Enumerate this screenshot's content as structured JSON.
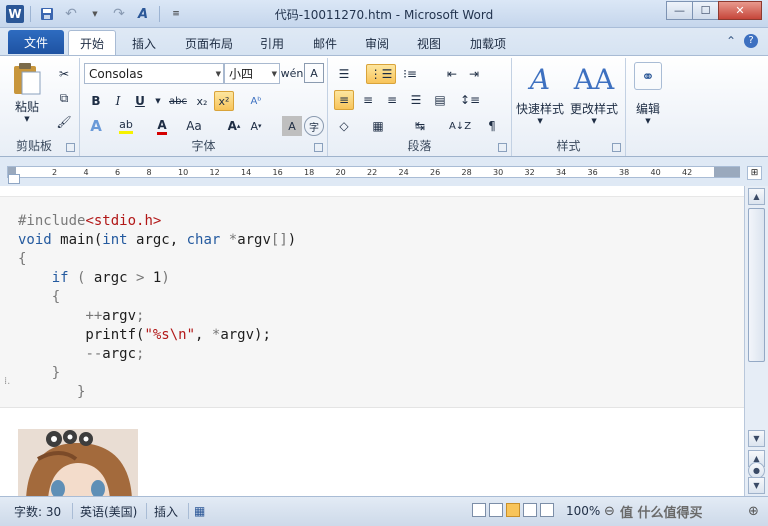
{
  "window": {
    "title": "代码-10011270.htm  -  Microsoft Word",
    "minimize": "—",
    "maximize": "☐",
    "close": "✕"
  },
  "tabs": {
    "file": "文件",
    "items": [
      "开始",
      "插入",
      "页面布局",
      "引用",
      "邮件",
      "审阅",
      "视图",
      "加载项"
    ],
    "active": "开始"
  },
  "ribbon": {
    "clipboard": {
      "paste": "粘贴",
      "label": "剪贴板"
    },
    "font": {
      "family": "Consolas",
      "size": "小四",
      "label": "字体"
    },
    "paragraph": {
      "label": "段落"
    },
    "styles": {
      "quick": "快速样式",
      "change": "更改样式",
      "label": "样式"
    },
    "editing": {
      "label": "编辑"
    }
  },
  "ruler": {
    "ticks": [
      "2",
      "4",
      "6",
      "8",
      "10",
      "12",
      "14",
      "16",
      "18",
      "20",
      "22",
      "24",
      "26",
      "28",
      "30",
      "32",
      "34",
      "36",
      "38",
      "40",
      "42"
    ]
  },
  "document": {
    "code_lines": [
      {
        "parts": [
          {
            "c": "pp",
            "t": "#include"
          },
          {
            "c": "str",
            "t": "<stdio.h>"
          }
        ]
      },
      {
        "parts": [
          {
            "c": "kw",
            "t": "void"
          },
          {
            "c": "",
            "t": " main("
          },
          {
            "c": "kw",
            "t": "int"
          },
          {
            "c": "",
            "t": " argc, "
          },
          {
            "c": "kw",
            "t": "char"
          },
          {
            "c": "",
            "t": " "
          },
          {
            "c": "op",
            "t": "*"
          },
          {
            "c": "",
            "t": "argv"
          },
          {
            "c": "op",
            "t": "[]"
          },
          {
            "c": "",
            "t": ")"
          }
        ]
      },
      {
        "parts": [
          {
            "c": "op",
            "t": "{"
          }
        ]
      },
      {
        "parts": [
          {
            "c": "",
            "t": "    "
          },
          {
            "c": "kw",
            "t": "if"
          },
          {
            "c": "",
            "t": " "
          },
          {
            "c": "op",
            "t": "("
          },
          {
            "c": "",
            "t": " argc "
          },
          {
            "c": "op",
            "t": ">"
          },
          {
            "c": "",
            "t": " 1"
          },
          {
            "c": "op",
            "t": ")"
          }
        ]
      },
      {
        "parts": [
          {
            "c": "",
            "t": "    "
          },
          {
            "c": "op",
            "t": "{"
          }
        ]
      },
      {
        "parts": [
          {
            "c": "",
            "t": "        "
          },
          {
            "c": "op",
            "t": "++"
          },
          {
            "c": "",
            "t": "argv"
          },
          {
            "c": "op",
            "t": ";"
          }
        ]
      },
      {
        "parts": [
          {
            "c": "",
            "t": "        printf("
          },
          {
            "c": "str",
            "t": "\"%s\\n\""
          },
          {
            "c": "",
            "t": ", "
          },
          {
            "c": "op",
            "t": "*"
          },
          {
            "c": "",
            "t": "argv);"
          }
        ]
      },
      {
        "parts": [
          {
            "c": "",
            "t": "        "
          },
          {
            "c": "op",
            "t": "--"
          },
          {
            "c": "",
            "t": "argc"
          },
          {
            "c": "op",
            "t": ";"
          }
        ]
      },
      {
        "parts": [
          {
            "c": "",
            "t": "    "
          },
          {
            "c": "op",
            "t": "}"
          }
        ]
      },
      {
        "parts": [
          {
            "c": "",
            "t": "       "
          },
          {
            "c": "op",
            "t": "}"
          }
        ]
      }
    ],
    "line_tops": [
      26,
      45,
      64,
      83,
      102,
      121,
      140,
      159,
      178,
      197
    ]
  },
  "statusbar": {
    "wordcount": "字数: 30",
    "language": "英语(美国)",
    "mode": "插入",
    "zoom": "100%",
    "watermark": "值 什么值得买"
  },
  "colors": {
    "accent": "#2b5797",
    "file_tab": "#1e52a2",
    "highlight": "#f8c45a"
  }
}
